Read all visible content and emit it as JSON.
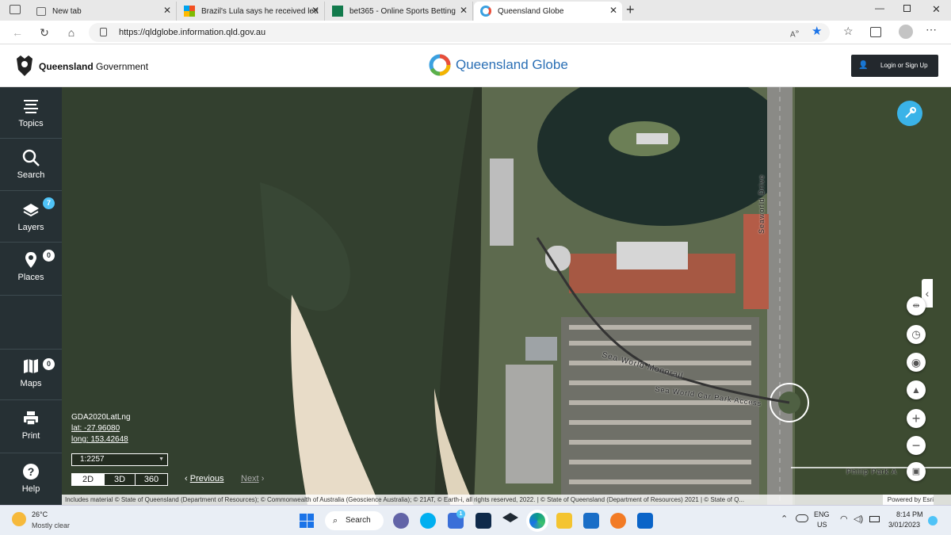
{
  "browser": {
    "tabs": [
      {
        "title": "New tab",
        "icon": "new-tab-icon"
      },
      {
        "title": "Brazil's Lula says he received lett",
        "icon": "microsoft-icon"
      },
      {
        "title": "bet365 - Online Sports Betting",
        "icon": "bet365-icon"
      },
      {
        "title": "Queensland Globe",
        "icon": "globe-icon",
        "active": true
      }
    ],
    "url": "https://qldglobe.information.qld.gov.au"
  },
  "header": {
    "gov_label_bold": "Queensland",
    "gov_label": "Government",
    "app_title": "Queensland Globe",
    "login_label": "Login or Sign Up"
  },
  "sidebar": {
    "items": [
      {
        "label": "Topics",
        "icon": "topics-icon"
      },
      {
        "label": "Search",
        "icon": "search-icon"
      },
      {
        "label": "Layers",
        "icon": "layers-icon",
        "badge": "7"
      },
      {
        "label": "Places",
        "icon": "places-icon",
        "badge": "0"
      },
      {
        "label": "Maps",
        "icon": "maps-icon",
        "badge": "0"
      },
      {
        "label": "Print",
        "icon": "print-icon"
      },
      {
        "label": "Help",
        "icon": "help-icon"
      }
    ]
  },
  "map": {
    "datum": "GDA2020LatLng",
    "lat": "lat: -27.96080",
    "long": "long: 153.42648",
    "scale": "1:2257",
    "view_modes": [
      "2D",
      "3D",
      "360"
    ],
    "previous_label": "Previous",
    "next_label": "Next",
    "attribution": "Includes material © State of Queensland (Department of Resources); © Commonwealth of Australia (Geoscience Australia); © 21AT, © Earth-i, all rights reserved, 2022. | © State of Queensland (Department of Resources) 2021 | © State of Q...",
    "powered_by": "Powered by Esri",
    "labels": {
      "monorail": "Sea World Monorail",
      "car_park": "Sea World Car Park Access",
      "seaworld_drive": "Seaworld Drive",
      "philip_park": "Philip Park A"
    }
  },
  "taskbar": {
    "weather_temp": "26°C",
    "weather_desc": "Mostly clear",
    "search_label": "Search",
    "lang_top": "ENG",
    "lang_bottom": "US",
    "time": "8:14 PM",
    "date": "3/01/2023",
    "store_badge": "1"
  },
  "colors": {
    "sidebar_bg": "#263034",
    "badge_blue": "#4fc3f7",
    "login_bg": "#23282d",
    "accent_blue": "#3aa0e0"
  }
}
